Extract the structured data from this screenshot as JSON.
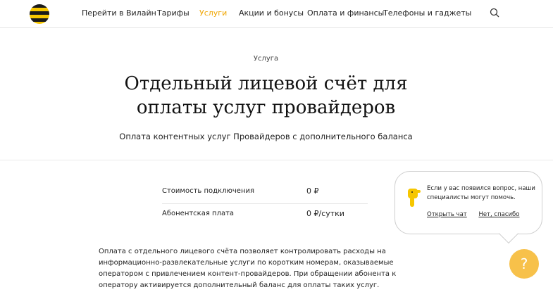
{
  "header": {
    "nav": [
      {
        "label": "Перейти в Вилайн",
        "active": false
      },
      {
        "label": "Тарифы",
        "active": false
      },
      {
        "label": "Услуги",
        "active": true
      },
      {
        "label": "Акции и бонусы",
        "active": false
      },
      {
        "label": "Оплата и финансы",
        "active": false
      },
      {
        "label": "Телефоны и гаджеты",
        "active": false
      }
    ],
    "search_icon": "search-icon"
  },
  "hero": {
    "eyebrow": "Услуга",
    "title_line1": "Отдельный лицевой счёт для",
    "title_line2": "оплаты услуг провайдеров",
    "subtitle": "Оплата контентных услуг Провайдеров с дополнительного баланса"
  },
  "params": [
    {
      "label": "Стоимость подключения",
      "value": "0 ₽"
    },
    {
      "label": "Абонентская плата",
      "value": "0 ₽/сутки"
    }
  ],
  "description": "Оплата с отдельного лицевого счёта позволяет контролировать расходы на информационно-развлекательные услуги по коротким номерам, оказываемые оператором с привлечением контент-провайдеров. При обращении абонента к оператору активируется дополнительный баланс для оплаты таких услуг.",
  "chat": {
    "text": "Если у вас появился вопрос, наши специалисты могут помочь.",
    "open_label": "Открыть чат",
    "dismiss_label": "Нет, спасибо",
    "help_label": "?"
  },
  "colors": {
    "accent": "#f0a500",
    "help_button": "#f7c14a",
    "logo_yellow": "#f6c600"
  }
}
